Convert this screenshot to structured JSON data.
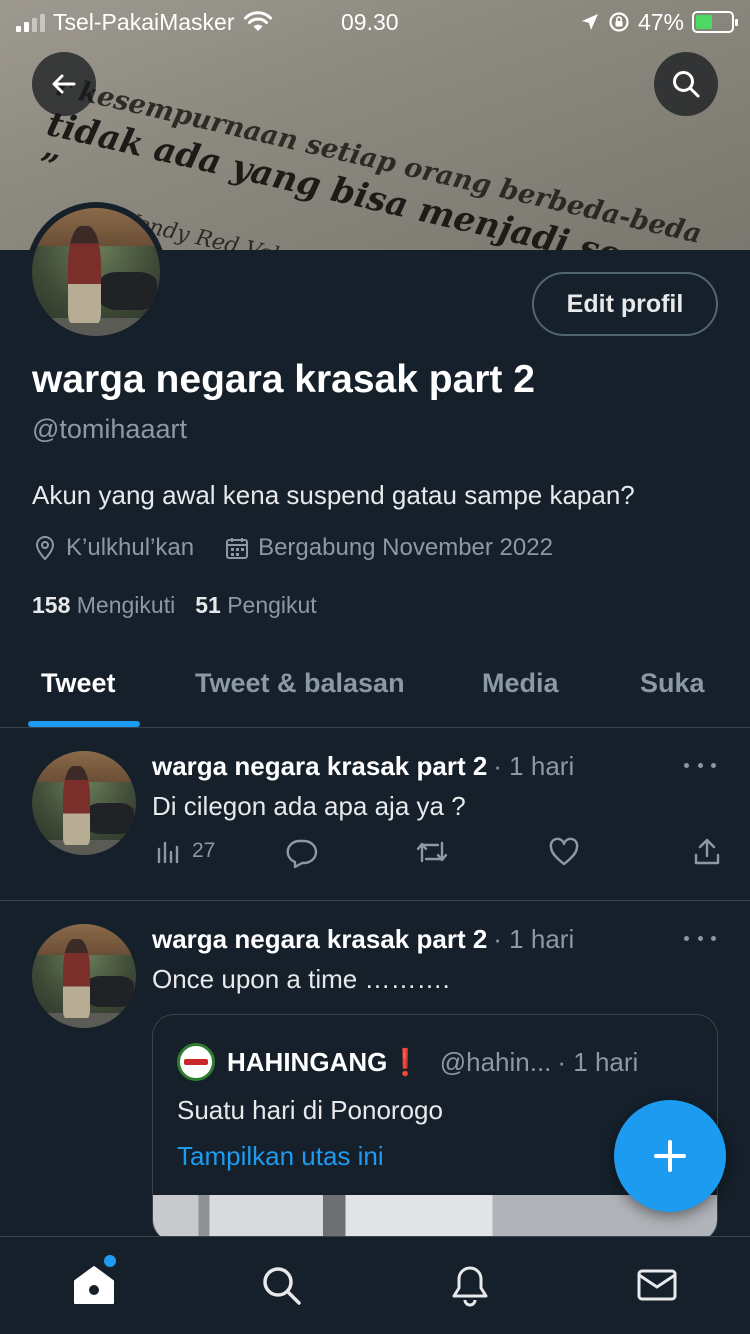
{
  "status_bar": {
    "carrier": "Tsel-PakaiMasker",
    "time": "09.30",
    "battery_percent": "47%",
    "battery_level": 0.47
  },
  "banner": {
    "quote_line1": "r kesempurnaan setiap orang berbeda-beda",
    "quote_line2": "tidak ada yang bisa menjadi sempurna ”",
    "quote_line3": "(Wendy Red Velvet)"
  },
  "profile": {
    "edit_button": "Edit profil",
    "display_name": "warga negara krasak part 2",
    "handle": "@tomihaaart",
    "bio": "Akun yang awal kena suspend gatau sampe kapan?",
    "location": "K’ulkhul’kan",
    "joined": "Bergabung November 2022",
    "following_count": "158",
    "following_label": "Mengikuti",
    "followers_count": "51",
    "followers_label": "Pengikut"
  },
  "tabs": [
    {
      "label": "Tweet",
      "active": true
    },
    {
      "label": "Tweet & balasan",
      "active": false
    },
    {
      "label": "Media",
      "active": false
    },
    {
      "label": "Suka",
      "active": false
    }
  ],
  "tweets": [
    {
      "author": "warga negara krasak part 2",
      "time": "· 1 hari",
      "text": "Di cilegon ada apa aja ya ?",
      "views": "27"
    },
    {
      "author": "warga negara krasak part 2",
      "time": "· 1 hari",
      "text": "Once upon a time ……….",
      "quote": {
        "author": "HAHINGANG",
        "badge": "❗",
        "handle": "@hahin...",
        "time": "· 1 hari",
        "text": "Suatu hari di Ponorogo",
        "link": "Tampilkan utas ini"
      }
    }
  ],
  "icons": {
    "back": "arrow-left-icon",
    "search": "search-icon",
    "compose": "plus-icon",
    "nav": [
      "home-icon",
      "search-icon",
      "bell-icon",
      "mail-icon"
    ]
  },
  "colors": {
    "background": "#15202b",
    "accent": "#1d9bf0",
    "muted": "#8b98a5",
    "divider": "#38444d"
  }
}
